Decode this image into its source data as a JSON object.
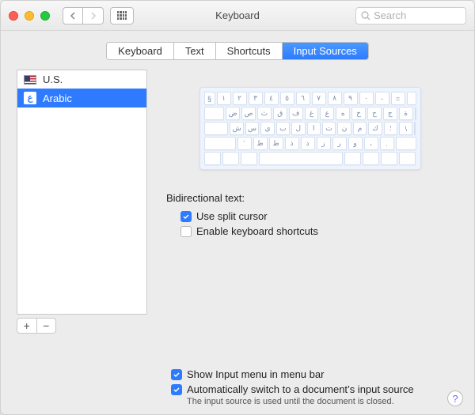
{
  "window": {
    "title": "Keyboard",
    "search_placeholder": "Search"
  },
  "tabs": [
    {
      "label": "Keyboard"
    },
    {
      "label": "Text"
    },
    {
      "label": "Shortcuts"
    },
    {
      "label": "Input Sources"
    }
  ],
  "active_tab": 3,
  "sources": [
    {
      "label": "U.S.",
      "flag": "us",
      "selected": false
    },
    {
      "label": "Arabic",
      "flag": "ar",
      "selected": true
    }
  ],
  "keyboard_rows": [
    [
      "§",
      "١",
      "٢",
      "٣",
      "٤",
      "٥",
      "٦",
      "٧",
      "٨",
      "٩",
      "٠",
      "-",
      "="
    ],
    [
      "ض",
      "ص",
      "ث",
      "ق",
      "ف",
      "غ",
      "ع",
      "ه",
      "خ",
      "ح",
      "ج",
      "ة"
    ],
    [
      "ش",
      "س",
      "ي",
      "ب",
      "ل",
      "ا",
      "ت",
      "ن",
      "م",
      "ك",
      "؛",
      "\\"
    ],
    [
      "`",
      "ظ",
      "ط",
      "ذ",
      "د",
      "ز",
      "ر",
      "و",
      "،",
      "."
    ]
  ],
  "bidi": {
    "title": "Bidirectional text:",
    "split_cursor_label": "Use split cursor",
    "split_cursor_checked": true,
    "kbd_shortcuts_label": "Enable keyboard shortcuts",
    "kbd_shortcuts_checked": false
  },
  "footer": {
    "show_menu_label": "Show Input menu in menu bar",
    "show_menu_checked": true,
    "auto_switch_label": "Automatically switch to a document’s input source",
    "auto_switch_checked": true,
    "hint": "The input source is used until the document is closed."
  },
  "icons": {
    "add": "+",
    "remove": "−",
    "help": "?",
    "arabic_glyph": "ع"
  }
}
